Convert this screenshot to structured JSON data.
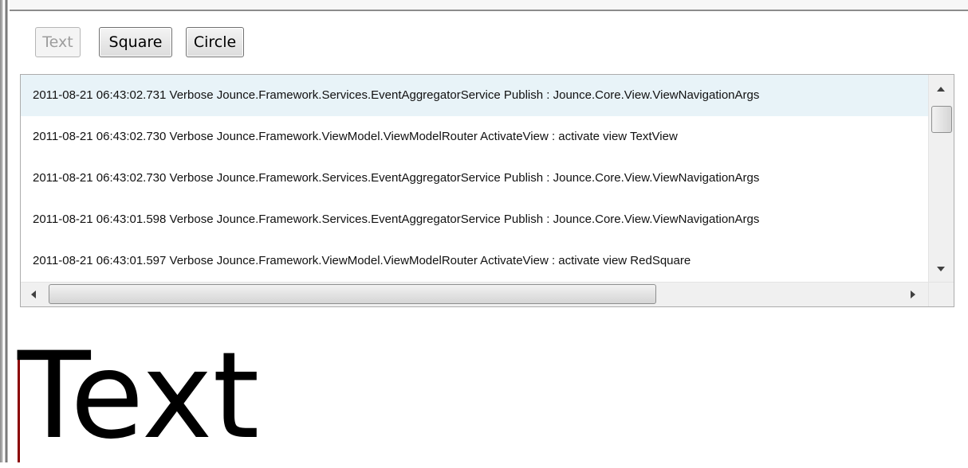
{
  "toolbar": {
    "text_label": "Text",
    "square_label": "Square",
    "circle_label": "Circle"
  },
  "log_list": {
    "rows": [
      "2011-08-21 06:43:02.731 Verbose Jounce.Framework.Services.EventAggregatorService Publish : Jounce.Core.View.ViewNavigationArgs",
      "2011-08-21 06:43:02.730 Verbose Jounce.Framework.ViewModel.ViewModelRouter ActivateView : activate view TextView",
      "2011-08-21 06:43:02.730 Verbose Jounce.Framework.Services.EventAggregatorService Publish : Jounce.Core.View.ViewNavigationArgs",
      "2011-08-21 06:43:01.598 Verbose Jounce.Framework.Services.EventAggregatorService Publish : Jounce.Core.View.ViewNavigationArgs",
      "2011-08-21 06:43:01.597 Verbose Jounce.Framework.ViewModel.ViewModelRouter ActivateView : activate view RedSquare"
    ],
    "selected_index": 0
  },
  "content": {
    "display_text": "Text"
  },
  "colors": {
    "selected_row": "#e8f3f8",
    "marker": "#8b0000"
  },
  "icons": [
    "scroll-up-arrow-icon",
    "scroll-down-arrow-icon",
    "scroll-left-arrow-icon",
    "scroll-right-arrow-icon"
  ]
}
